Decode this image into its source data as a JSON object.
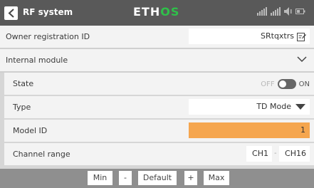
{
  "header": {
    "title": "RF system",
    "brand_main": "ETH",
    "brand_accent": "OS",
    "icons": [
      "back-icon",
      "signal-strength-icon",
      "signal-strength-icon",
      "speaker-icon",
      "battery-icon"
    ]
  },
  "rows": {
    "owner": {
      "label": "Owner registration ID",
      "value": "SRtqxtrs"
    },
    "internal": {
      "label": "Internal module"
    },
    "state": {
      "label": "State",
      "off": "OFF",
      "on": "ON"
    },
    "type": {
      "label": "Type",
      "value": "TD Mode"
    },
    "model_id": {
      "label": "Model ID",
      "value": "1"
    },
    "channel_range": {
      "label": "Channel range",
      "from": "CH1",
      "dash": "-",
      "to": "CH16"
    }
  },
  "bottom": {
    "min": "Min",
    "minus": "-",
    "default": "Default",
    "plus": "+",
    "max": "Max"
  },
  "colors": {
    "header_bg": "#595959",
    "brand_accent": "#2fc04a",
    "highlight": "#f5a64f",
    "bottom_bg": "#8f8f8f"
  }
}
